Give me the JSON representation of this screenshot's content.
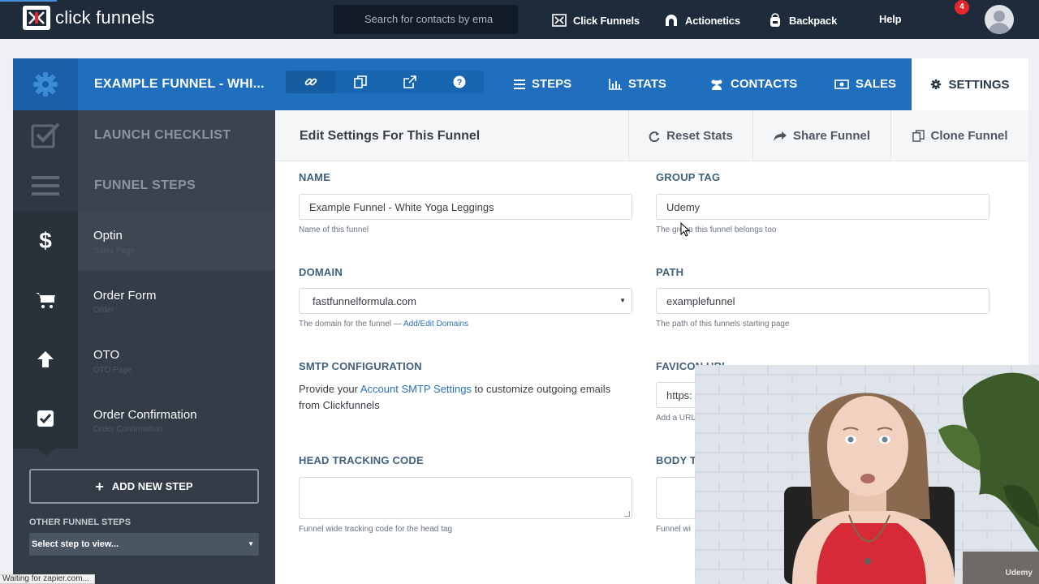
{
  "brand": {
    "name": "click funnels"
  },
  "search": {
    "placeholder": "Search for contacts by ema"
  },
  "topnav": {
    "items": [
      {
        "label": "Click Funnels",
        "icon": "clickfunnels-icon"
      },
      {
        "label": "Actionetics",
        "icon": "actionetics-icon"
      },
      {
        "label": "Backpack",
        "icon": "backpack-icon"
      },
      {
        "label": "Help"
      }
    ],
    "notification_count": "4"
  },
  "funnel": {
    "title": "EXAMPLE FUNNEL - WHI...",
    "tabs": [
      {
        "label": "STEPS",
        "icon": "list-icon"
      },
      {
        "label": "STATS",
        "icon": "bar-chart-icon"
      },
      {
        "label": "CONTACTS",
        "icon": "users-icon"
      },
      {
        "label": "SALES",
        "icon": "money-icon"
      },
      {
        "label": "SETTINGS",
        "icon": "gear-icon",
        "active": true
      }
    ]
  },
  "sidebar": {
    "launch_checklist": "LAUNCH CHECKLIST",
    "funnel_steps": "FUNNEL STEPS",
    "steps": [
      {
        "title": "Optin",
        "subtitle": "Sales Page",
        "icon": "dollar-icon"
      },
      {
        "title": "Order Form",
        "subtitle": "Order",
        "icon": "cart-icon"
      },
      {
        "title": "OTO",
        "subtitle": "OTO Page",
        "icon": "arrow-up-icon"
      },
      {
        "title": "Order Confirmation",
        "subtitle": "Order Confirmation",
        "icon": "check-square-icon"
      }
    ],
    "add_step": "ADD NEW STEP",
    "other_steps_label": "OTHER FUNNEL STEPS",
    "select_placeholder": "Select step to view..."
  },
  "main": {
    "title": "Edit Settings For This Funnel",
    "actions": [
      {
        "label": "Reset Stats",
        "icon": "refresh-icon"
      },
      {
        "label": "Share Funnel",
        "icon": "share-icon"
      },
      {
        "label": "Clone Funnel",
        "icon": "copy-icon"
      }
    ],
    "fields": {
      "name": {
        "label": "NAME",
        "value": "Example Funnel - White Yoga Leggings",
        "help": "Name of this funnel"
      },
      "group_tag": {
        "label": "GROUP TAG",
        "value": "Udemy",
        "help": "The group this funnel belongs too"
      },
      "domain": {
        "label": "DOMAIN",
        "value": "fastfunnelformula.com",
        "help": "The domain for the funnel —",
        "help_link": "Add/Edit Domains"
      },
      "path": {
        "label": "PATH",
        "value": "examplefunnel",
        "help": "The path of this funnels starting page"
      },
      "smtp": {
        "label": "SMTP CONFIGURATION",
        "text_before": "Provide your ",
        "link": "Account SMTP Settings",
        "text_after": " to customize outgoing emails from Clickfunnels"
      },
      "favicon": {
        "label": "FAVICON URL",
        "value": "https:",
        "help": "Add a URL"
      },
      "head_tracking": {
        "label": "HEAD TRACKING CODE",
        "help": "Funnel wide tracking code for the head tag"
      },
      "body_tracking": {
        "label": "BODY T",
        "help": "Funnel wi"
      }
    }
  },
  "webcam": {
    "watermark": "Udemy"
  },
  "statusbar": {
    "text": "Waiting for zapier.com..."
  },
  "colors": {
    "nav": "#1d2b3a",
    "brand_blue": "#1f6fbe",
    "sidebar": "#333c47",
    "link": "#2b70b8",
    "badge": "#e0282e"
  }
}
